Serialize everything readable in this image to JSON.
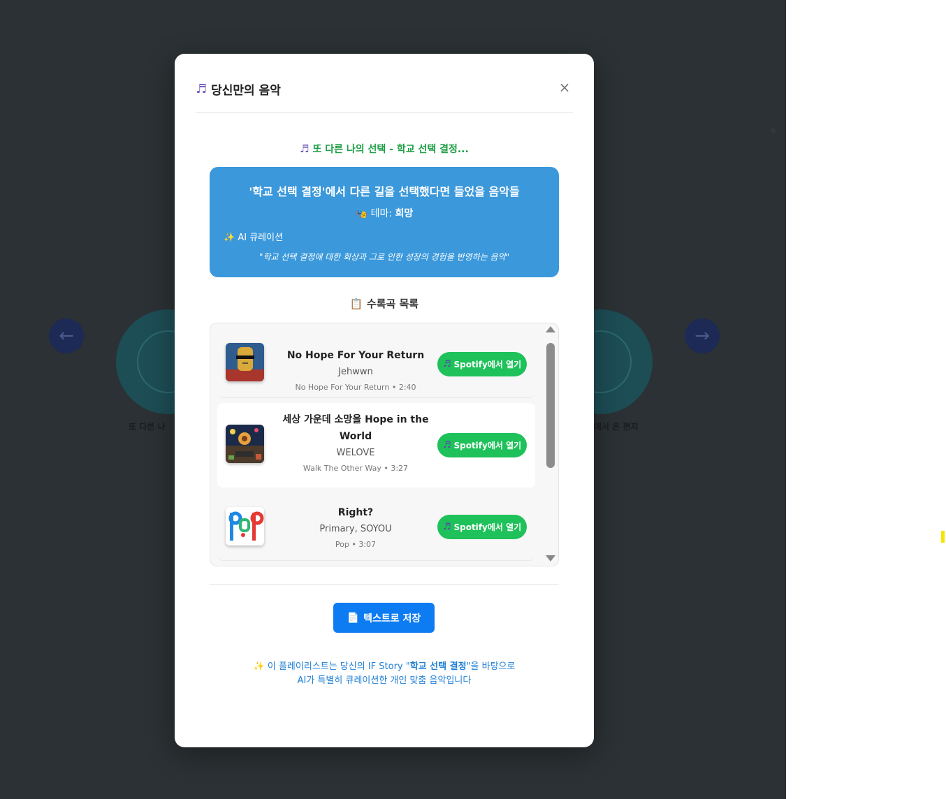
{
  "background": {
    "left_label": "또 다른 나",
    "right_label": "에서 온 편지"
  },
  "modal": {
    "title": "당신만의 음악",
    "close_label": "×",
    "subtitle": "또 다른 나의 선택 - 학교 선택 결정...",
    "card": {
      "title": "'학교 선택 결정'에서 다른 길을 선택했다면 들었을 음악들",
      "theme_prefix": "테마: ",
      "theme_value": "희망",
      "ai_label": "AI 큐레이션",
      "quote": "\"학교 선택 결정에 대한 회상과 그로 인한 성장의 경험을 반영하는 음악\""
    },
    "tracklist_title": "수록곡 목록",
    "tracks": [
      {
        "name": "No Hope For Your Return",
        "artist": "Jehwwn",
        "meta": "No Hope For Your Return • 2:40",
        "button": "Spotify에서 열기"
      },
      {
        "name": "세상 가운데 소망을 Hope in the World",
        "artist": "WELOVE",
        "meta": "Walk The Other Way • 3:27",
        "button": "Spotify에서 열기"
      },
      {
        "name": "Right?",
        "artist": "Primary, SOYOU",
        "meta": "Pop • 3:07",
        "button": "Spotify에서 열기"
      }
    ],
    "save_button": "텍스트로 저장",
    "footer": {
      "line1_prefix": "이 플레이리스트는 당신의 IF Story \"",
      "line1_bold": "학교 선택 결정",
      "line1_suffix": "\"을 바탕으로",
      "line2": "AI가 특별히 큐레이션한 개인 맞춤 음악입니다"
    }
  },
  "icons": {
    "title": "music-note-icon",
    "theme": "mask-icon",
    "ai": "sparkles-icon",
    "tracklist": "clipboard-icon",
    "save": "document-icon"
  },
  "colors": {
    "spotify_green": "#1ec15a",
    "card_blue": "#3a98db",
    "save_blue": "#0d7cf2",
    "subtitle_green": "#1e9e45"
  }
}
